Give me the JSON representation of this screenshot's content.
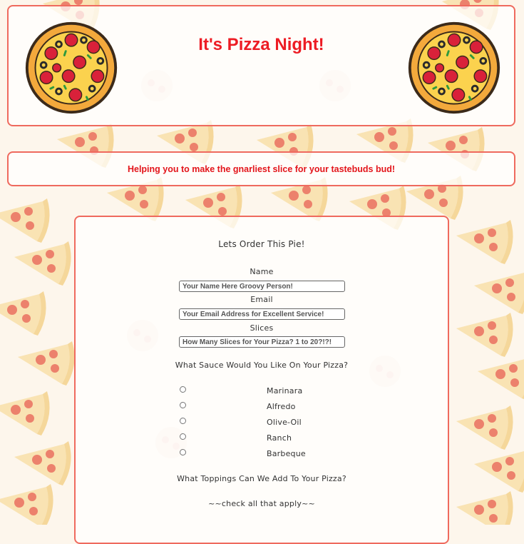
{
  "header": {
    "title": "It's Pizza Night!"
  },
  "tagline": "Helping you to make the gnarliest slice for your tastebuds bud!",
  "form": {
    "title": "Lets Order This Pie!",
    "name_label": "Name",
    "name_placeholder": "Your Name Here Groovy Person!",
    "email_label": "Email",
    "email_placeholder": "Your Email Address for Excellent Service!",
    "slices_label": "Slices",
    "slices_placeholder": "How Many Slices for Your Pizza? 1 to 20?!?!",
    "sauce_question": "What Sauce Would You Like On Your Pizza?",
    "sauces": [
      "Marinara",
      "Alfredo",
      "Olive-Oil",
      "Ranch",
      "Barbeque"
    ],
    "toppings_question": "What Toppings Can We Add To Your Pizza?",
    "toppings_hint": "~~check all that apply~~"
  },
  "icons": {
    "logo": "pizza-icon",
    "background": "pizza-slice-pattern"
  },
  "colors": {
    "accent": "#ed1c24",
    "border": "#ef6a5e",
    "background": "#fdf6ec"
  }
}
